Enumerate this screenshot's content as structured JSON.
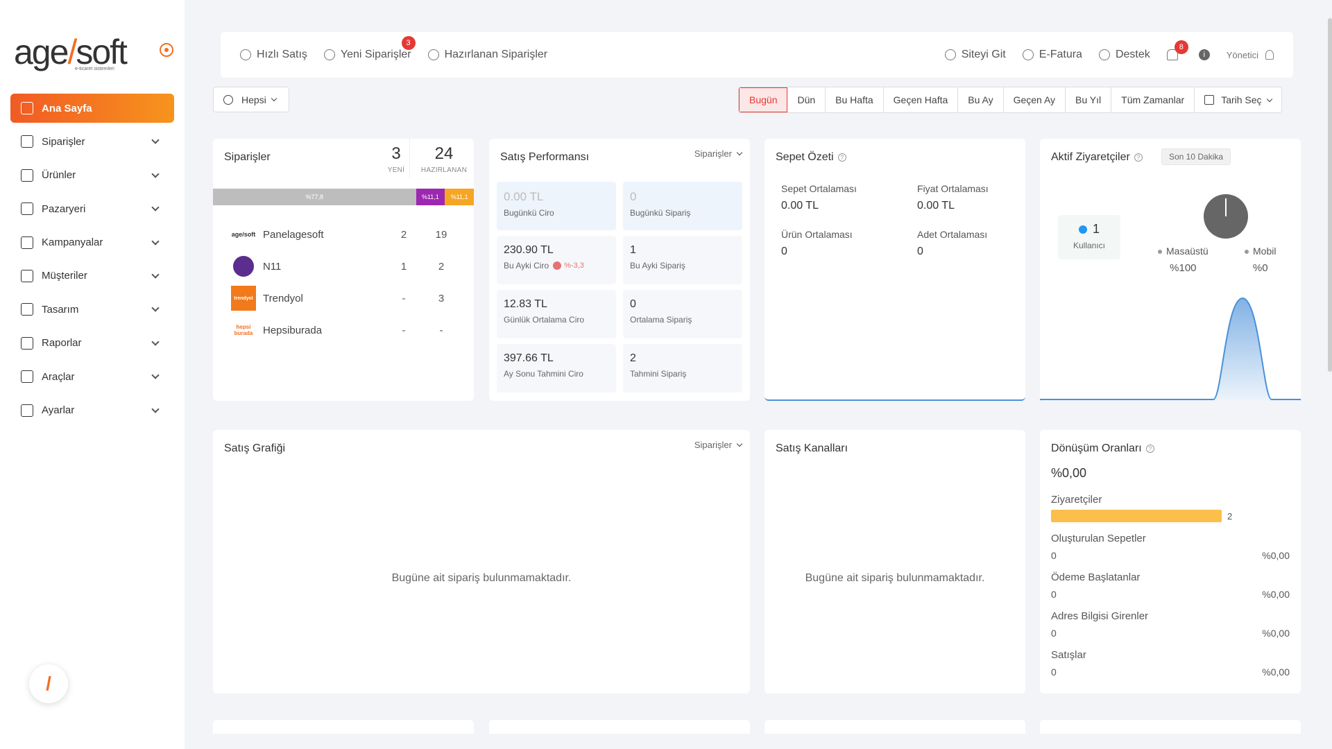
{
  "brand": {
    "logo_main": "age",
    "logo_slash": "/",
    "logo_end": "soft",
    "logo_tagline": "e-ticaret sistemleri"
  },
  "nav": [
    {
      "label": "Ana Sayfa",
      "active": true
    },
    {
      "label": "Siparişler"
    },
    {
      "label": "Ürünler"
    },
    {
      "label": "Pazaryeri"
    },
    {
      "label": "Kampanyalar"
    },
    {
      "label": "Müşteriler"
    },
    {
      "label": "Tasarım"
    },
    {
      "label": "Raporlar"
    },
    {
      "label": "Araçlar"
    },
    {
      "label": "Ayarlar"
    }
  ],
  "fab_label": "/",
  "topbar": {
    "quick_sale": "Hızlı Satış",
    "new_orders": "Yeni Siparişler",
    "new_orders_badge": "3",
    "prepared_orders": "Hazırlanan Siparişler",
    "go_site": "Siteyi Git",
    "einvoice": "E-Fatura",
    "support": "Destek",
    "notif_badge": "8",
    "info": "i",
    "user": "Yönetici"
  },
  "filter": {
    "label": "Hepsi"
  },
  "periods": [
    "Bugün",
    "Dün",
    "Bu Hafta",
    "Geçen Hafta",
    "Bu Ay",
    "Geçen Ay",
    "Bu Yıl",
    "Tüm Zamanlar"
  ],
  "date_pick": "Tarih Seç",
  "orders": {
    "title": "Siparişler",
    "new_count": "3",
    "new_label": "YENİ",
    "prep_count": "24",
    "prep_label": "HAZIRLANAN",
    "bar": [
      {
        "label": "%77,8",
        "pct": 77.8,
        "color": "#bdbdbd"
      },
      {
        "label": "%11,1",
        "pct": 11.1,
        "color": "#9c27b0"
      },
      {
        "label": "%11,1",
        "pct": 11.1,
        "color": "#f5a623"
      }
    ],
    "marketplaces": [
      {
        "name": "Panelagesoft",
        "a": "2",
        "b": "19",
        "logo": "agesoft"
      },
      {
        "name": "N11",
        "a": "1",
        "b": "2",
        "logo": "n11"
      },
      {
        "name": "Trendyol",
        "a": "-",
        "b": "3",
        "logo": "trendyol"
      },
      {
        "name": "Hepsiburada",
        "a": "-",
        "b": "-",
        "logo": "hepsiburada"
      }
    ]
  },
  "performance": {
    "title": "Satış Performansı",
    "dropdown": "Siparişler",
    "cells": [
      {
        "value": "0.00 TL",
        "label": "Bugünkü Ciro",
        "blue": true
      },
      {
        "value": "0",
        "label": "Bugünkü Sipariş",
        "blue": true
      },
      {
        "value": "230.90 TL",
        "label": "Bu Ayki Ciro",
        "change": "%-3,3"
      },
      {
        "value": "1",
        "label": "Bu Ayki Sipariş"
      },
      {
        "value": "12.83 TL",
        "label": "Günlük Ortalama Ciro"
      },
      {
        "value": "0",
        "label": "Ortalama Sipariş"
      },
      {
        "value": "397.66 TL",
        "label": "Ay Sonu Tahmini Ciro"
      },
      {
        "value": "2",
        "label": "Tahmini Sipariş"
      }
    ]
  },
  "basket": {
    "title": "Sepet Özeti",
    "help": "?",
    "items": [
      {
        "label": "Sepet Ortalaması",
        "value": "0.00 TL"
      },
      {
        "label": "Fiyat Ortalaması",
        "value": "0.00 TL"
      },
      {
        "label": "Ürün Ortalaması",
        "value": "0"
      },
      {
        "label": "Adet Ortalaması",
        "value": "0"
      }
    ]
  },
  "visitors": {
    "title": "Aktif Ziyaretçiler",
    "help": "?",
    "chip": "Son 10 Dakika",
    "count": "1",
    "count_label": "Kullanıcı",
    "desktop_label": "Masaüstü",
    "desktop_pct": "%100",
    "mobile_label": "Mobil",
    "mobile_pct": "%0"
  },
  "sales_chart": {
    "title": "Satış Grafiği",
    "dropdown": "Siparişler",
    "empty": "Bugüne ait sipariş bulunmamaktadır."
  },
  "channels": {
    "title": "Satış Kanalları",
    "empty": "Bugüne ait sipariş bulunmamaktadır."
  },
  "conversion": {
    "title": "Dönüşüm Oranları",
    "help": "?",
    "total": "%0,00",
    "visitors_label": "Ziyaretçiler",
    "visitors_count": "2",
    "visitors_fill": 1.0,
    "rows": [
      {
        "label": "Oluşturulan Sepetler",
        "count": "0",
        "pct": "%0,00"
      },
      {
        "label": "Ödeme Başlatanlar",
        "count": "0",
        "pct": "%0,00"
      },
      {
        "label": "Adres Bilgisi Girenler",
        "count": "0",
        "pct": "%0,00"
      },
      {
        "label": "Satışlar",
        "count": "0",
        "pct": "%0,00"
      }
    ]
  }
}
